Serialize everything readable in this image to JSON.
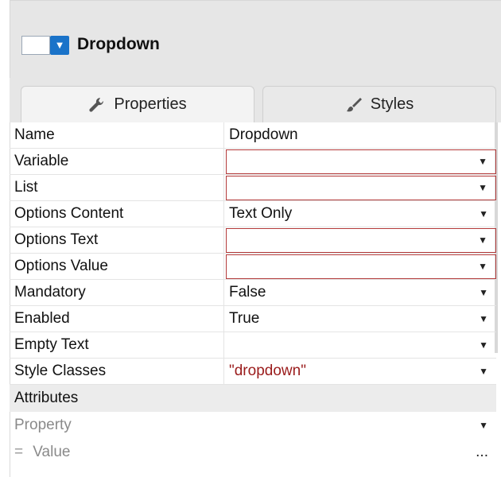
{
  "header": {
    "title": "Dropdown",
    "icon": "dropdown-widget-icon"
  },
  "tabs": [
    {
      "label": "Properties",
      "icon": "wrench-icon",
      "active": true
    },
    {
      "label": "Styles",
      "icon": "brush-icon",
      "active": false
    }
  ],
  "properties": [
    {
      "name": "Name",
      "value": "Dropdown",
      "dropdown": false,
      "invalid": false,
      "value_color": "normal"
    },
    {
      "name": "Variable",
      "value": "",
      "dropdown": true,
      "invalid": true,
      "value_color": "normal"
    },
    {
      "name": "List",
      "value": "",
      "dropdown": true,
      "invalid": true,
      "value_color": "normal"
    },
    {
      "name": "Options Content",
      "value": "Text Only",
      "dropdown": true,
      "invalid": false,
      "value_color": "normal"
    },
    {
      "name": "Options Text",
      "value": "",
      "dropdown": true,
      "invalid": true,
      "value_color": "normal"
    },
    {
      "name": "Options Value",
      "value": "",
      "dropdown": true,
      "invalid": true,
      "value_color": "normal"
    },
    {
      "name": "Mandatory",
      "value": "False",
      "dropdown": true,
      "invalid": false,
      "value_color": "normal"
    },
    {
      "name": "Enabled",
      "value": "True",
      "dropdown": true,
      "invalid": false,
      "value_color": "normal"
    },
    {
      "name": "Empty Text",
      "value": "",
      "dropdown": true,
      "invalid": false,
      "value_color": "normal"
    },
    {
      "name": "Style Classes",
      "value": "\"dropdown\"",
      "dropdown": true,
      "invalid": false,
      "value_color": "red"
    }
  ],
  "attributes": {
    "section_label": "Attributes",
    "property_placeholder": "Property",
    "value_prefix": "=",
    "value_placeholder": "Value",
    "more_label": "..."
  },
  "colors": {
    "accent": "#1a73c9",
    "invalid_border": "#b33a3a",
    "string_value": "#9a1b1b"
  }
}
